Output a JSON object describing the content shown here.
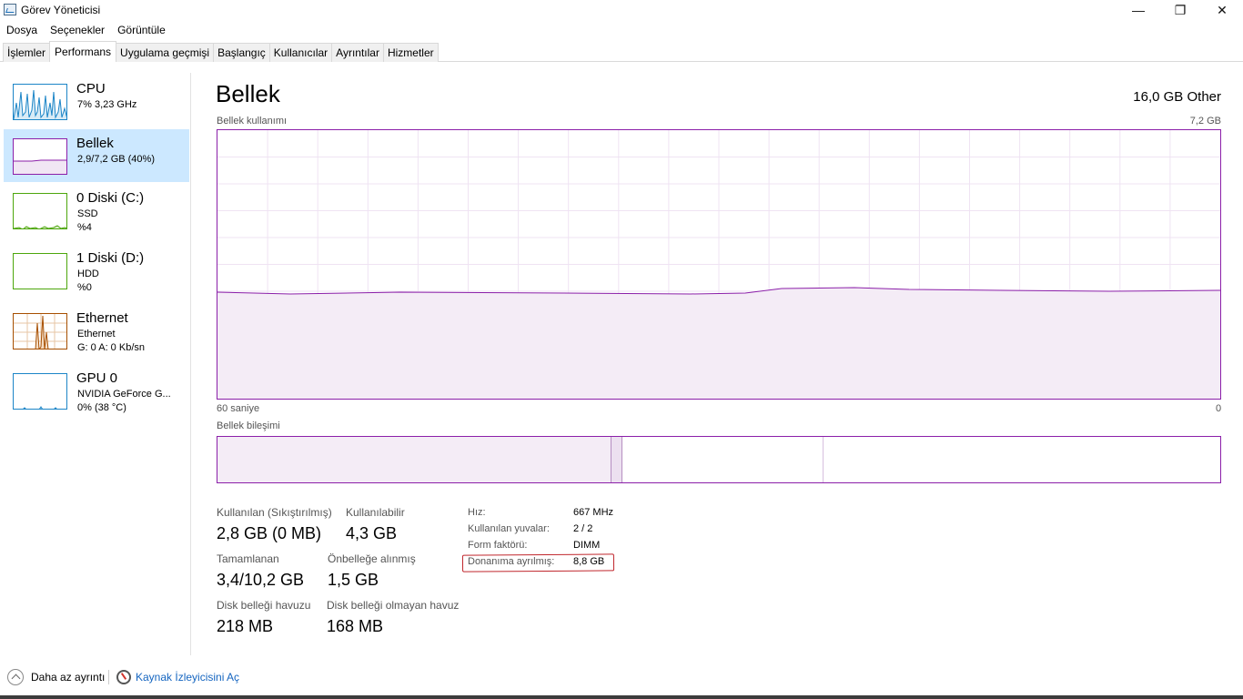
{
  "window": {
    "title": "Görev Yöneticisi",
    "controls": {
      "minimize": "—",
      "maximize": "❐",
      "close": "✕"
    }
  },
  "menu": [
    "Dosya",
    "Seçenekler",
    "Görüntüle"
  ],
  "tabs": [
    "İşlemler",
    "Performans",
    "Uygulama geçmişi",
    "Başlangıç",
    "Kullanıcılar",
    "Ayrıntılar",
    "Hizmetler"
  ],
  "active_tab": "Performans",
  "sidebar": [
    {
      "title": "CPU",
      "line1": "7% 3,23 GHz",
      "line2": "",
      "color": "#1c85c7"
    },
    {
      "title": "Bellek",
      "line1": "2,9/7,2 GB (40%)",
      "line2": "",
      "color": "#8b1fa9"
    },
    {
      "title": "0 Diski (C:)",
      "line1": "SSD",
      "line2": "%4",
      "color": "#4da60c"
    },
    {
      "title": "1 Diski (D:)",
      "line1": "HDD",
      "line2": "%0",
      "color": "#4da60c"
    },
    {
      "title": "Ethernet",
      "line1": "Ethernet",
      "line2": "G: 0 A: 0 Kb/sn",
      "color": "#a74f01"
    },
    {
      "title": "GPU 0",
      "line1": "NVIDIA GeForce G...",
      "line2": "0% (38 °C)",
      "color": "#1c85c7"
    }
  ],
  "memory": {
    "title": "Bellek",
    "total": "16,0 GB Other",
    "usage_label": "Bellek kullanımı",
    "usage_max": "7,2 GB",
    "time_label": "60 saniye",
    "time_end": "0",
    "composition_label": "Bellek bileşimi",
    "usage_fraction": 0.4,
    "accent": "#8b1fa9"
  },
  "stats": {
    "in_use_label": "Kullanılan (Sıkıştırılmış)",
    "in_use_value": "2,8 GB (0 MB)",
    "available_label": "Kullanılabilir",
    "available_value": "4,3 GB",
    "committed_label": "Tamamlanan",
    "committed_value": "3,4/10,2 GB",
    "cached_label": "Önbelleğe alınmış",
    "cached_value": "1,5 GB",
    "paged_label": "Disk belleği havuzu",
    "paged_value": "218 MB",
    "nonpaged_label": "Disk belleği olmayan havuz",
    "nonpaged_value": "168 MB"
  },
  "specs": {
    "speed_label": "Hız:",
    "speed_value": "667 MHz",
    "slots_label": "Kullanılan yuvalar:",
    "slots_value": "2 / 2",
    "form_label": "Form faktörü:",
    "form_value": "DIMM",
    "reserved_label": "Donanıma ayrılmış:",
    "reserved_value": "8,8 GB"
  },
  "footer": {
    "fewer_details": "Daha az ayrıntı",
    "resource_monitor": "Kaynak İzleyicisini Aç"
  }
}
